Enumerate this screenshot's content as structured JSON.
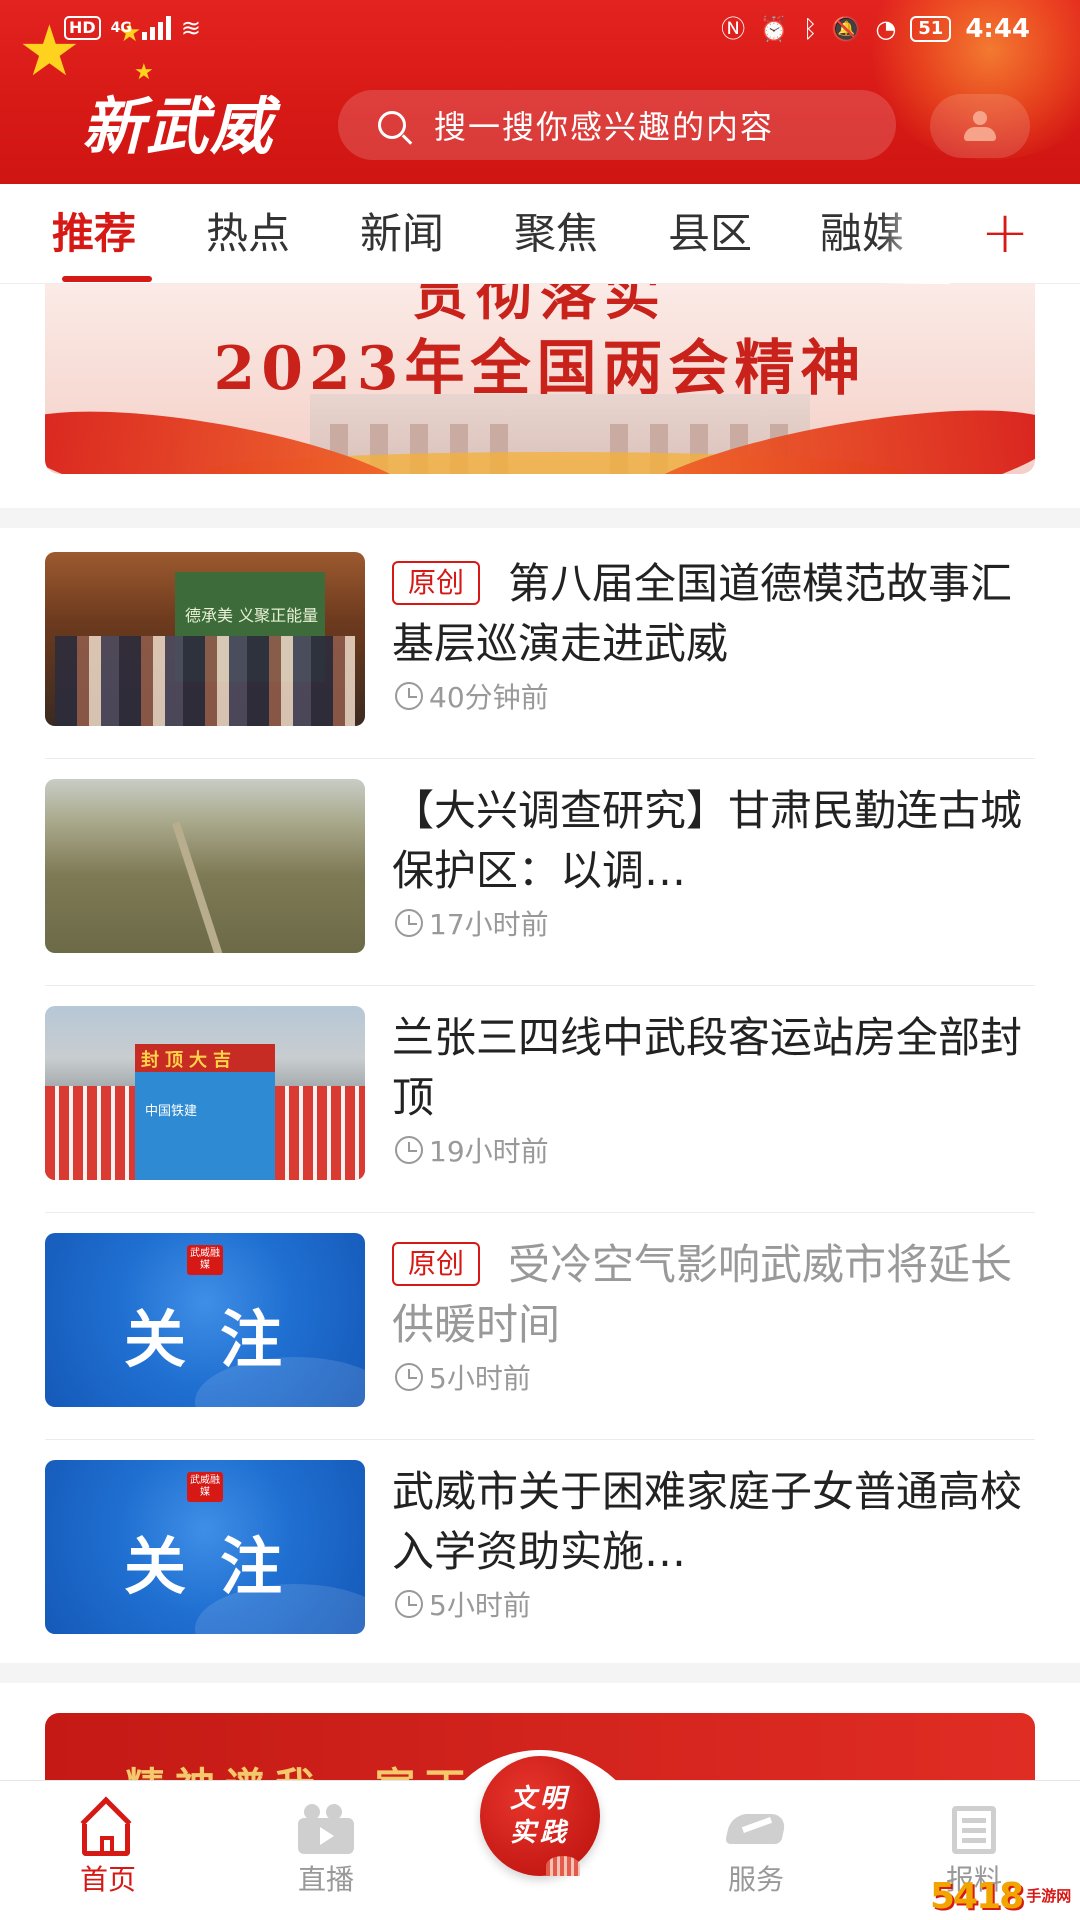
{
  "status_bar": {
    "hd": "HD",
    "network": "4G",
    "battery": "51",
    "time": "4:44"
  },
  "header": {
    "logo": "新武威",
    "search_placeholder": "搜一搜你感兴趣的内容",
    "accent_color": "#d71916"
  },
  "tabs": [
    {
      "label": "推荐",
      "active": true
    },
    {
      "label": "热点",
      "active": false
    },
    {
      "label": "新闻",
      "active": false
    },
    {
      "label": "聚焦",
      "active": false
    },
    {
      "label": "县区",
      "active": false
    },
    {
      "label": "融媒",
      "active": false
    }
  ],
  "tabs_add": "+",
  "banner": {
    "top_line": "贯彻落实",
    "main_line": "2023年全国两会精神"
  },
  "news": [
    {
      "tag": "原创",
      "title": "第八届全国道德模范故事汇基层巡演走进武威",
      "time": "40分钟前",
      "thumb_caption": "德承美 义聚正能量",
      "faded": false
    },
    {
      "tag": "",
      "title": "【大兴调查研究】甘肃民勤连古城保护区：以调…",
      "time": "17小时前",
      "thumb_caption": "",
      "faded": false
    },
    {
      "tag": "",
      "title": "兰张三四线中武段客运站房全部封顶",
      "time": "19小时前",
      "thumb_caption": "封顶大吉",
      "thumb_sub": "中国铁建",
      "faded": false
    },
    {
      "tag": "原创",
      "title": "受冷空气影响武威市将延长供暖时间",
      "time": "5小时前",
      "thumb_caption": "关注",
      "thumb_badge": "武威融媒",
      "faded": true
    },
    {
      "tag": "",
      "title": "武威市关于困难家庭子女普通高校入学资助实施…",
      "time": "5小时前",
      "thumb_caption": "关注",
      "thumb_badge": "武威融媒",
      "faded": false
    }
  ],
  "promo": {
    "text": "精神谱我…室丁"
  },
  "bottom_nav": {
    "items": [
      {
        "label": "首页",
        "icon": "home-icon",
        "active": true
      },
      {
        "label": "直播",
        "icon": "live-camera-icon",
        "active": false
      },
      {
        "label": "服务",
        "icon": "handshake-icon",
        "active": false
      },
      {
        "label": "报料",
        "icon": "report-icon",
        "active": false
      }
    ],
    "center_button": "文明实践"
  },
  "watermark": {
    "number": "5418",
    "site": "手游网"
  }
}
